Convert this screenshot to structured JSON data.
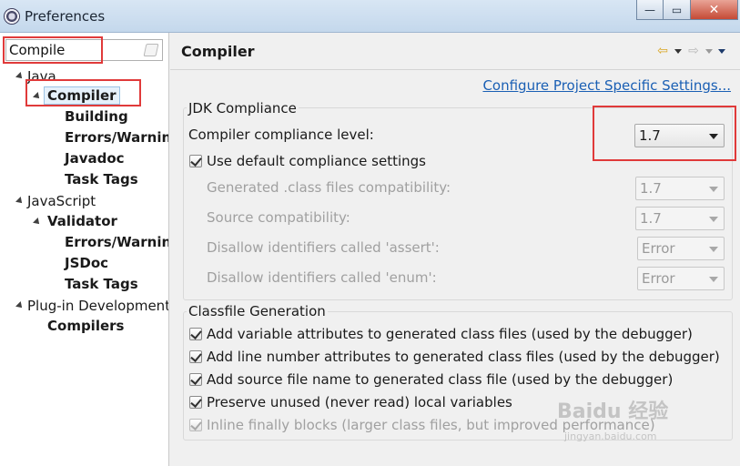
{
  "window": {
    "title": "Preferences",
    "minimize_label": "—",
    "maximize_label": "▭",
    "close_label": "✕"
  },
  "filter": {
    "value": "Compile"
  },
  "tree": [
    {
      "label": "Java",
      "level": 0,
      "bold": false
    },
    {
      "label": "Compiler",
      "level": 1,
      "bold": true
    },
    {
      "label": "Building",
      "level": 2,
      "bold": true
    },
    {
      "label": "Errors/Warnings",
      "level": 2,
      "bold": true
    },
    {
      "label": "Javadoc",
      "level": 2,
      "bold": true
    },
    {
      "label": "Task Tags",
      "level": 2,
      "bold": true
    },
    {
      "label": "JavaScript",
      "level": 0,
      "bold": false
    },
    {
      "label": "Validator",
      "level": 1,
      "bold": true
    },
    {
      "label": "Errors/Warnings",
      "level": 2,
      "bold": true
    },
    {
      "label": "JSDoc",
      "level": 2,
      "bold": true
    },
    {
      "label": "Task Tags",
      "level": 2,
      "bold": true
    },
    {
      "label": "Plug-in Development",
      "level": 0,
      "bold": false
    },
    {
      "label": "Compilers",
      "level": 1,
      "bold": true
    }
  ],
  "page": {
    "title": "Compiler",
    "config_link": "Configure Project Specific Settings...",
    "back_icon": "back-arrow-icon",
    "forward_icon": "forward-arrow-icon"
  },
  "jdk": {
    "group_label": "JDK Compliance",
    "compliance_label": "Compiler compliance level:",
    "compliance_value": "1.7",
    "use_default_label": "Use default compliance settings",
    "use_default_checked": true,
    "generated_label": "Generated .class files compatibility:",
    "generated_value": "1.7",
    "source_label": "Source compatibility:",
    "source_value": "1.7",
    "assert_label": "Disallow identifiers called 'assert':",
    "assert_value": "Error",
    "enum_label": "Disallow identifiers called 'enum':",
    "enum_value": "Error"
  },
  "classfile": {
    "group_label": "Classfile Generation",
    "options": [
      {
        "label": "Add variable attributes to generated class files (used by the debugger)",
        "checked": true,
        "enabled": true
      },
      {
        "label": "Add line number attributes to generated class files (used by the debugger)",
        "checked": true,
        "enabled": true
      },
      {
        "label": "Add source file name to generated class file (used by the debugger)",
        "checked": true,
        "enabled": true
      },
      {
        "label": "Preserve unused (never read) local variables",
        "checked": true,
        "enabled": true
      },
      {
        "label": "Inline finally blocks (larger class files, but improved performance)",
        "checked": true,
        "enabled": false
      }
    ]
  },
  "watermark": {
    "text": "Baidu 经验",
    "sub": "jingyan.baidu.com"
  },
  "colors": {
    "highlight": "#e03a3a",
    "link": "#1a5fb4",
    "titlebar": "#c4d8ec"
  }
}
